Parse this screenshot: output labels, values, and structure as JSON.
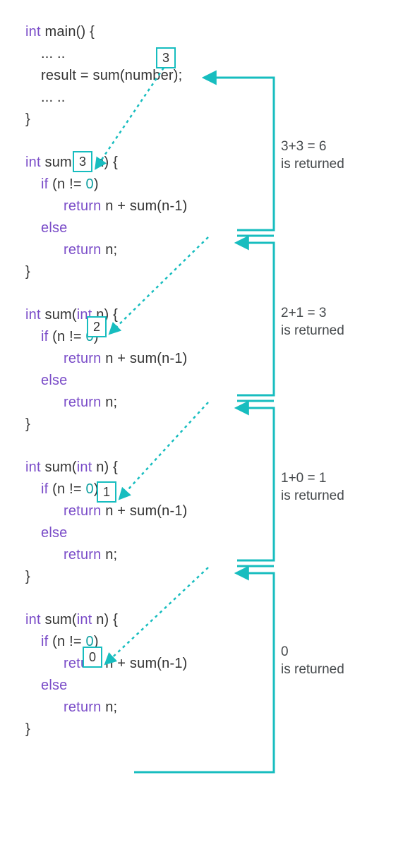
{
  "main": {
    "sig_kw": "int",
    "sig_rest": " main() {",
    "dots1": "... ..",
    "call_line": "result = sum(number);",
    "dots2": "... ..",
    "close": "}",
    "argbox": "3"
  },
  "sum_blocks": [
    {
      "argbox": "3",
      "sig_kw": "int",
      "sig_name": " sum(",
      "sig_param_kw": "int",
      "sig_param_rest": " n) {",
      "if_kw": "if",
      "if_rest": " (n != ",
      "if_zero": "0",
      "if_close": ")",
      "ret1_kw": "return",
      "ret1_rest": " n + sum(n-1)",
      "else_kw": "else",
      "ret2_kw": "return",
      "ret2_rest": " n;",
      "close": "}"
    },
    {
      "argbox": "2",
      "sig_kw": "int",
      "sig_name": " sum(",
      "sig_param_kw": "int",
      "sig_param_rest": " n) {",
      "if_kw": "if",
      "if_rest": " (n != ",
      "if_zero": "0",
      "if_close": ")",
      "ret1_kw": "return",
      "ret1_rest": " n + sum(n-1)",
      "else_kw": "else",
      "ret2_kw": "return",
      "ret2_rest": " n;",
      "close": "}"
    },
    {
      "argbox": "1",
      "sig_kw": "int",
      "sig_name": " sum(",
      "sig_param_kw": "int",
      "sig_param_rest": " n) {",
      "if_kw": "if",
      "if_rest": " (n != ",
      "if_zero": "0",
      "if_close": ")",
      "ret1_kw": "return",
      "ret1_rest": " n + sum(n-1)",
      "else_kw": "else",
      "ret2_kw": "return",
      "ret2_rest": " n;",
      "close": "}"
    },
    {
      "argbox": "0",
      "sig_kw": "int",
      "sig_name": " sum(",
      "sig_param_kw": "int",
      "sig_param_rest": " n) {",
      "if_kw": "if",
      "if_rest": " (n != ",
      "if_zero": "0",
      "if_close": ")",
      "ret1_kw": "return",
      "ret1_rest": " n + sum(n-1)",
      "else_kw": "else",
      "ret2_kw": "return",
      "ret2_rest": " n;",
      "close": "}"
    }
  ],
  "return_labels": [
    {
      "line1": "3+3 = 6",
      "line2": "is returned"
    },
    {
      "line1": "2+1 = 3",
      "line2": "is returned"
    },
    {
      "line1": "1+0 = 1",
      "line2": "is returned"
    },
    {
      "line1": "0",
      "line2": "is returned"
    }
  ]
}
